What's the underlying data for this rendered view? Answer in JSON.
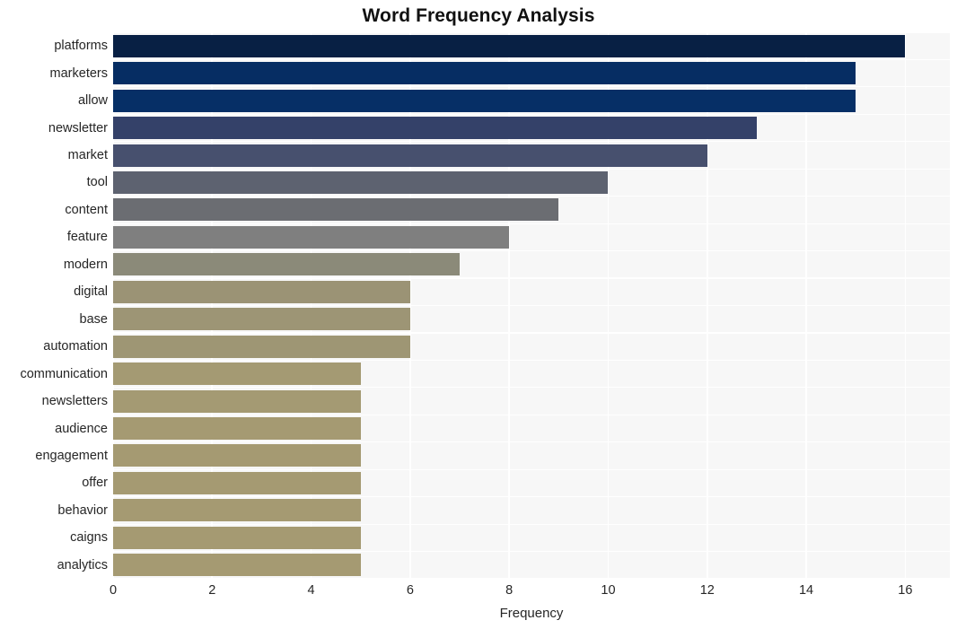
{
  "chart_data": {
    "type": "bar",
    "orientation": "horizontal",
    "title": "Word Frequency Analysis",
    "xlabel": "Frequency",
    "ylabel": "",
    "xlim": [
      0,
      16.9
    ],
    "ylim": [
      0,
      20
    ],
    "grid": true,
    "legend": null,
    "xticks": [
      "0",
      "2",
      "4",
      "6",
      "8",
      "10",
      "12",
      "14",
      "16"
    ],
    "xtick_values": [
      0,
      2,
      4,
      6,
      8,
      10,
      12,
      14,
      16
    ],
    "categories": [
      "platforms",
      "marketers",
      "allow",
      "newsletter",
      "market",
      "tool",
      "content",
      "feature",
      "modern",
      "digital",
      "base",
      "automation",
      "communication",
      "newsletters",
      "audience",
      "engagement",
      "offer",
      "behavior",
      "caigns",
      "analytics"
    ],
    "values": [
      16,
      15,
      15,
      13,
      12,
      10,
      9,
      8,
      7,
      6,
      6,
      6,
      5,
      5,
      5,
      5,
      5,
      5,
      5,
      5
    ],
    "bar_colors": [
      "#082044",
      "#062d63",
      "#062f66",
      "#344169",
      "#47506e",
      "#5d6270",
      "#6b6d72",
      "#7f7f7f",
      "#8b8a79",
      "#9b9375",
      "#9d9575",
      "#9e9674",
      "#a49a73",
      "#a49a73",
      "#a59a72",
      "#a59a72",
      "#a59a72",
      "#a59a72",
      "#a59a72",
      "#a59a72"
    ],
    "plot_background": "#f7f7f7",
    "gridline_color": "#ffffff",
    "figure_background": "#ffffff"
  }
}
